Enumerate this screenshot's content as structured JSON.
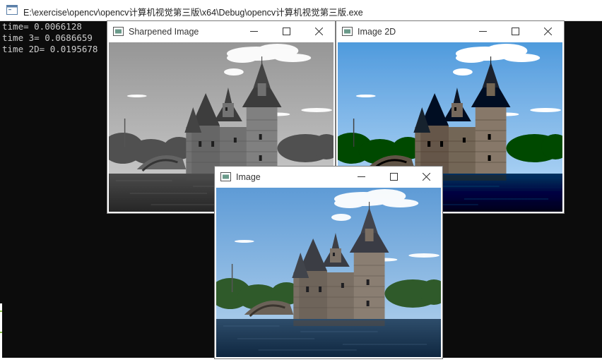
{
  "console": {
    "title": "E:\\exercise\\opencv\\opencv计算机视觉第三版\\x64\\Debug\\opencv计算机视觉第三版.exe",
    "lines": [
      "time= 0.0066128",
      "time 3= 0.0686659",
      "time 2D= 0.0195678"
    ]
  },
  "windows": [
    {
      "title": "Sharpened Image",
      "style": "grayscale"
    },
    {
      "title": "Image 2D",
      "style": "color-sharpened"
    },
    {
      "title": "Image",
      "style": "color"
    }
  ],
  "icons": {
    "app": "console-app-icon",
    "window": "image-window-icon",
    "minimize": "minimize-icon",
    "maximize": "maximize-icon",
    "close": "close-icon"
  },
  "colors": {
    "console_bg": "#0c0c0c",
    "console_text": "#cccccc",
    "sky_top": "#6fa8dc",
    "water": "#1d3e5e"
  }
}
